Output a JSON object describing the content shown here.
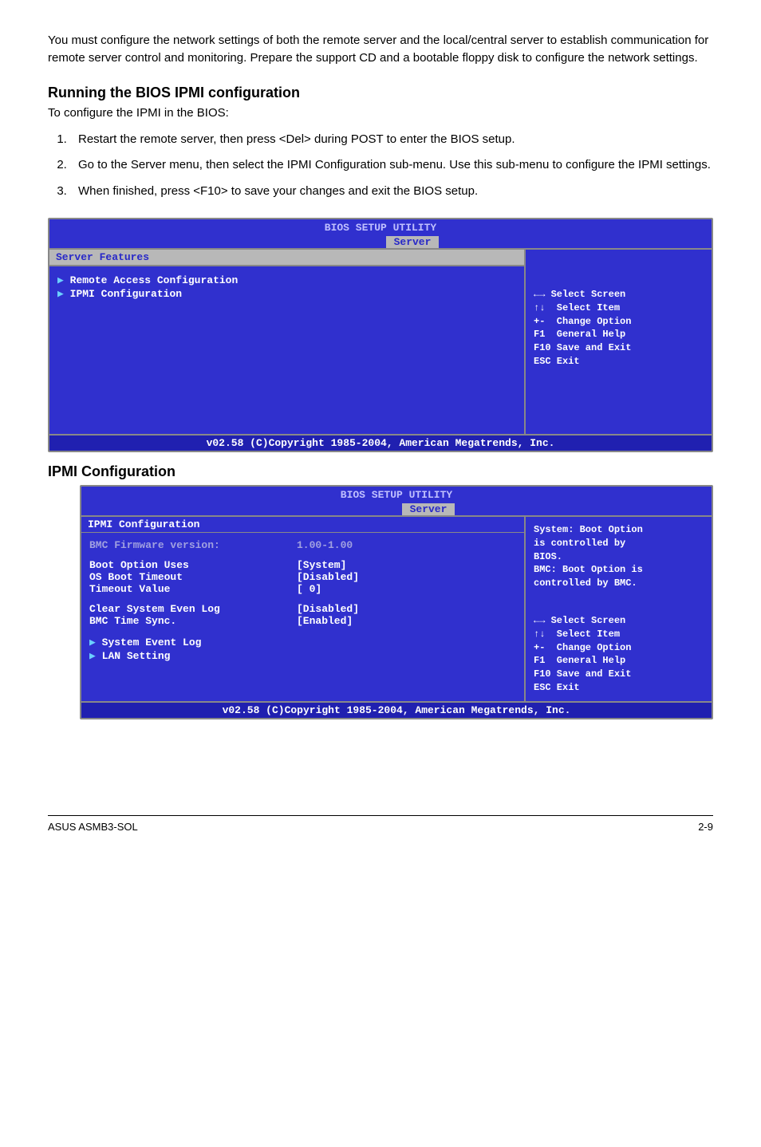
{
  "intro": "You must configure the network settings of both the remote server and the local/central server to establish communication for remote server control and monitoring. Prepare the support CD and a bootable floppy disk to configure the network settings.",
  "section1": {
    "heading": "Running the BIOS IPMI configuration",
    "lead": "To configure the IPMI in the BIOS:"
  },
  "steps": [
    "Restart the remote server, then press <Del> during POST to enter the BIOS setup.",
    "Go to the Server menu, then select the IPMI Configuration sub-menu. Use this sub-menu to configure the IPMI settings.",
    "When finished, press <F10> to save your changes and exit the BIOS setup."
  ],
  "bios1": {
    "title": "BIOS SETUP UTILITY",
    "tab": "Server",
    "panelTitle": "Server Features",
    "items": [
      "Remote Access Configuration",
      "IPMI Configuration"
    ],
    "help": [
      "←→ Select Screen",
      "↑↓  Select Item",
      "+-  Change Option",
      "F1  General Help",
      "F10 Save and Exit",
      "ESC Exit"
    ],
    "copyright": "v02.58 (C)Copyright 1985-2004, American Megatrends, Inc."
  },
  "section2": {
    "heading": "IPMI Configuration"
  },
  "bios2": {
    "title": "BIOS SETUP UTILITY",
    "tab": "Server",
    "panelTitle": "IPMI Configuration",
    "fw": {
      "label": "BMC Firmware version:",
      "value": "1.00-1.00"
    },
    "opts": [
      {
        "k": "Boot Option Uses",
        "v": "[System]"
      },
      {
        "k": "OS Boot Timeout",
        "v": "[Disabled]"
      },
      {
        "k": "Timeout Value",
        "v": "[  0]"
      }
    ],
    "opts2": [
      {
        "k": "Clear System Even Log",
        "v": "[Disabled]"
      },
      {
        "k": "BMC Time Sync.",
        "v": "[Enabled]"
      }
    ],
    "subs": [
      "System Event Log",
      "LAN Setting"
    ],
    "rhelp": [
      "System: Boot Option",
      "is controlled by",
      "BIOS.",
      "",
      "BMC: Boot Option is",
      "controlled by BMC."
    ],
    "help": [
      "←→ Select Screen",
      "↑↓  Select Item",
      "+-  Change Option",
      "F1  General Help",
      "F10 Save and Exit",
      "ESC Exit"
    ],
    "copyright": "v02.58 (C)Copyright 1985-2004, American Megatrends, Inc."
  },
  "footer": {
    "left": "ASUS ASMB3-SOL",
    "right": "2-9"
  }
}
